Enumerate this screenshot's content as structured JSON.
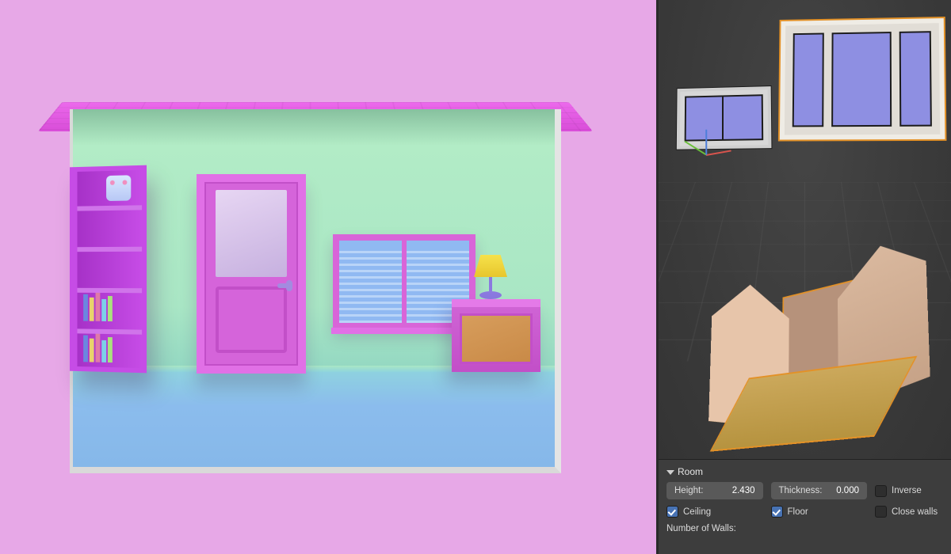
{
  "panel": {
    "title": "Room",
    "height": {
      "label": "Height:",
      "value": "2.430"
    },
    "thickness": {
      "label": "Thickness:",
      "value": "0.000"
    },
    "inverse": {
      "label": "Inverse",
      "checked": false
    },
    "ceiling": {
      "label": "Ceiling",
      "checked": true
    },
    "floor": {
      "label": "Floor",
      "checked": true
    },
    "close_walls": {
      "label": "Close walls",
      "checked": false
    },
    "num_walls_label": "Number of Walls:"
  },
  "models": {
    "small_window": "two-pane-window",
    "big_window_selected": "three-pane-window",
    "room_prefab": "room-walls"
  }
}
